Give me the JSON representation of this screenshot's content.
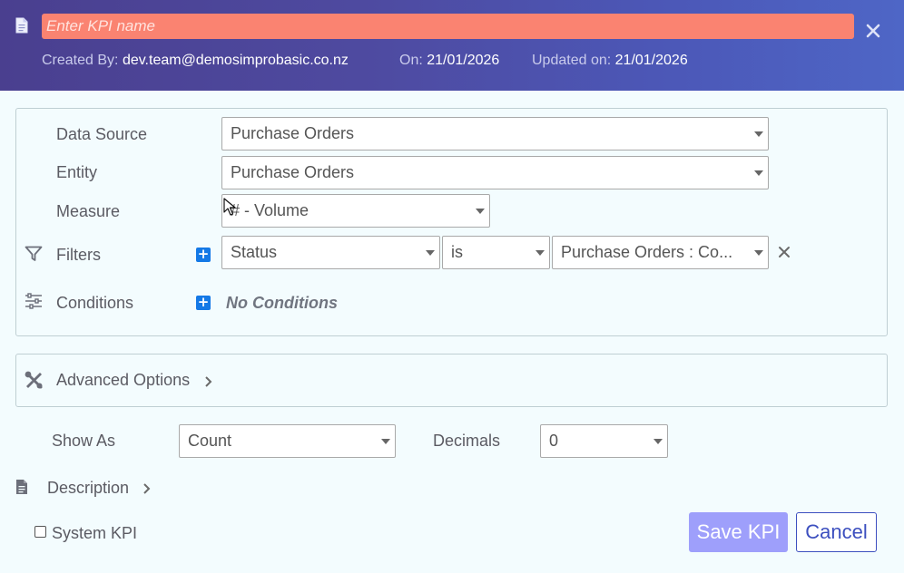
{
  "header": {
    "kpi_name_placeholder": "Enter KPI name",
    "kpi_name_value": "",
    "created_by_label": "Created By:",
    "created_by_value": "dev.team@demosimprobasic.co.nz",
    "on_label": "On:",
    "on_value": "21/01/2026",
    "updated_label": "Updated on:",
    "updated_value": "21/01/2026"
  },
  "form": {
    "data_source_label": "Data Source",
    "data_source_value": "Purchase Orders",
    "entity_label": "Entity",
    "entity_value": "Purchase Orders",
    "measure_label": "Measure",
    "measure_value": "# - Volume",
    "filters_label": "Filters",
    "filter": {
      "field": "Status",
      "operator": "is",
      "value": "Purchase Orders : Co..."
    },
    "conditions_label": "Conditions",
    "no_conditions": "No Conditions"
  },
  "advanced": {
    "label": "Advanced Options"
  },
  "display": {
    "show_as_label": "Show As",
    "show_as_value": "Count",
    "decimals_label": "Decimals",
    "decimals_value": "0"
  },
  "description": {
    "label": "Description"
  },
  "system_kpi": {
    "label": "System KPI",
    "checked": false
  },
  "actions": {
    "save_label": "Save KPI",
    "cancel_label": "Cancel"
  },
  "colors": {
    "header_start": "#4a3f8f",
    "header_end": "#4e66c6",
    "name_input_bg": "#fa8371",
    "plus_button": "#1479e6",
    "save_button": "#9e9ffb",
    "cancel_border": "#3c4fbf"
  }
}
